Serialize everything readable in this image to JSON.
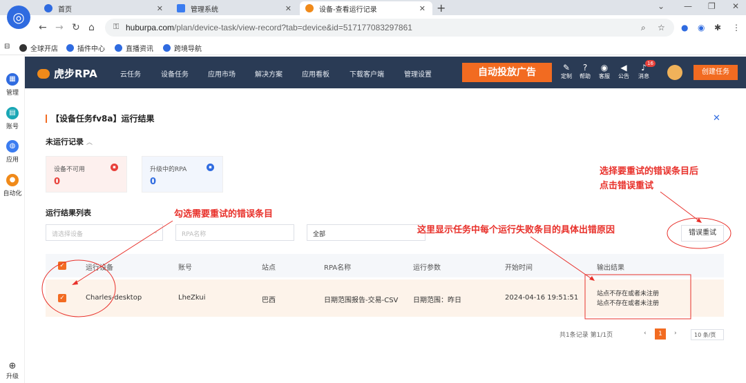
{
  "browser": {
    "tabs": [
      {
        "title": "首页",
        "active": false
      },
      {
        "title": "管理系统",
        "active": false
      },
      {
        "title": "设备-查看运行记录",
        "active": true
      }
    ],
    "url_host": "huburpa.com",
    "url_path": "/plan/device-task/view-record?tab=device&id=517177083297861",
    "bookmarks": [
      "全球开店",
      "插件中心",
      "直播资讯",
      "跨境导航"
    ]
  },
  "sidebar": {
    "items": [
      {
        "label": "管理",
        "icon": "grid-icon",
        "color": "#2f6be0"
      },
      {
        "label": "账号",
        "icon": "account-icon",
        "color": "#1aa7b5"
      },
      {
        "label": "应用",
        "icon": "app-icon",
        "color": "#3b7cf0"
      },
      {
        "label": "自动化",
        "icon": "tiger-icon",
        "color": "#f08a1a"
      }
    ],
    "upgrade_label": "升级"
  },
  "header": {
    "brand": "虎步RPA",
    "nav": [
      "云任务",
      "设备任务",
      "应用市场",
      "解决方案",
      "应用看板",
      "下载客户端",
      "管理设置"
    ],
    "promo": "自动投放广告",
    "icons": [
      {
        "label": "定制",
        "icon": "edit-icon"
      },
      {
        "label": "帮助",
        "icon": "help-icon"
      },
      {
        "label": "客服",
        "icon": "service-icon"
      },
      {
        "label": "公告",
        "icon": "announce-icon"
      },
      {
        "label": "消息",
        "icon": "bell-icon"
      }
    ],
    "message_count": "16",
    "create_task": "创建任务",
    "accent": "#f26b21"
  },
  "panel": {
    "title": "【设备任务fv8a】运行结果",
    "not_run_title": "未运行记录",
    "stats": [
      {
        "label": "设备不可用",
        "value": "0",
        "color": "#e8403a"
      },
      {
        "label": "升级中的RPA",
        "value": "0",
        "color": "#2f6be0"
      }
    ],
    "list_title": "运行结果列表",
    "filters": {
      "device_placeholder": "请选择设备",
      "rpa_placeholder": "RPA名称",
      "status_value": "全部"
    },
    "retry_button": "错误重试",
    "columns": [
      "运行设备",
      "账号",
      "站点",
      "RPA名称",
      "运行参数",
      "开始时间",
      "输出结果"
    ],
    "rows": [
      {
        "device": "Charles-desktop",
        "account": "LheZkui",
        "site": "巴西",
        "rpa": "日期范围报告-交易-CSV",
        "params": "日期范围：昨日",
        "start": "2024-04-16 19:51:51",
        "output_1": "站点不存在或者未注册",
        "output_2": "站点不存在或者未注册"
      }
    ],
    "pager": {
      "summary": "共1条记录 第1/1页",
      "current": "1",
      "page_size": "10 条/页"
    }
  },
  "annotations": {
    "check_hint": "勾选需要重试的错误条目",
    "error_hint": "这里显示任务中每个运行失败条目的具体出错原因",
    "retry_hint_1": "选择要重试的错误条目后",
    "retry_hint_2": "点击错误重试",
    "color": "#e8302a"
  }
}
